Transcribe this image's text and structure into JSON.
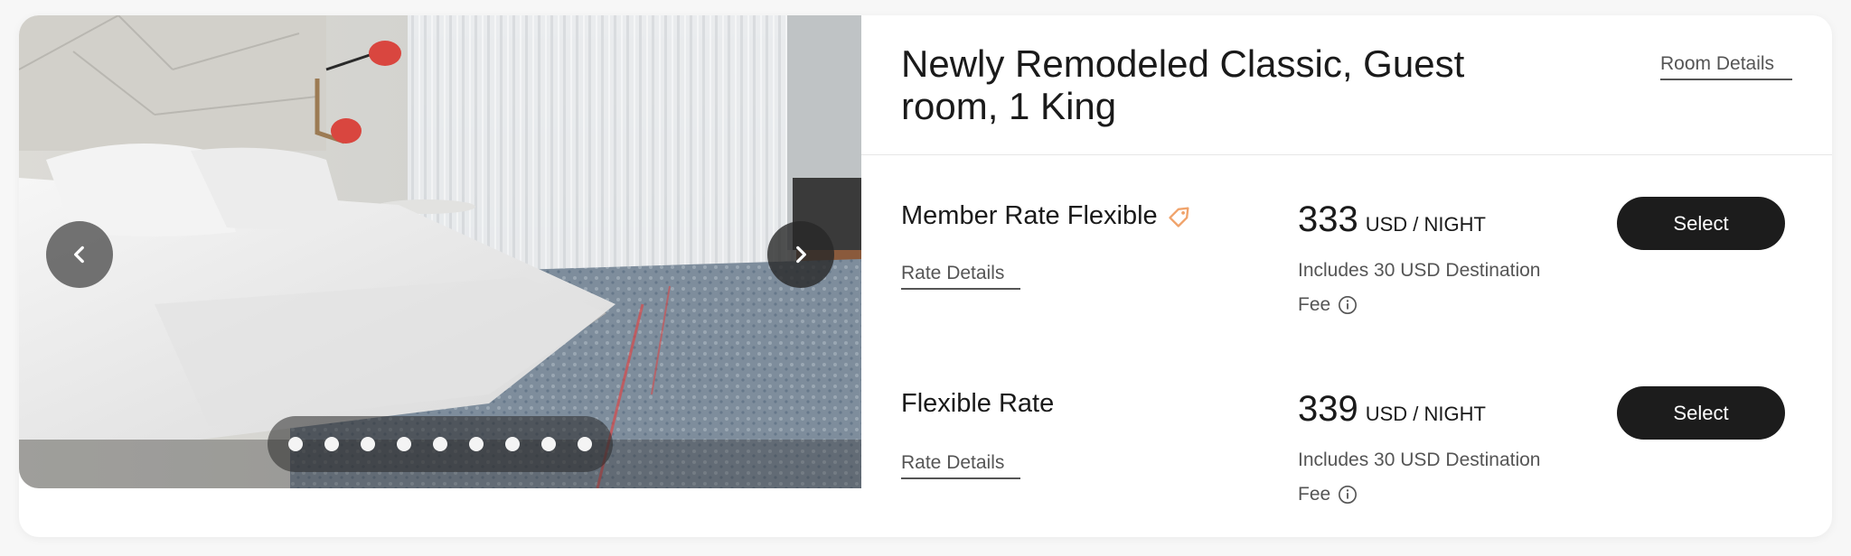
{
  "room": {
    "title": "Newly Remodeled Classic, Guest room, 1 King",
    "details_link": "Room Details"
  },
  "gallery": {
    "prev_icon": "chevron-left-icon",
    "next_icon": "chevron-right-icon",
    "dot_count": 9
  },
  "rates": [
    {
      "name": "Member Rate Flexible",
      "tag_icon": "tag-icon",
      "tag_color": "#f0a36b",
      "details_link": "Rate Details",
      "amount": "333",
      "unit": "USD / NIGHT",
      "fee_note": "Includes 30 USD Destination Fee",
      "select_label": "Select"
    },
    {
      "name": "Flexible Rate",
      "details_link": "Rate Details",
      "amount": "339",
      "unit": "USD / NIGHT",
      "fee_note": "Includes 30 USD Destination Fee",
      "select_label": "Select"
    }
  ]
}
